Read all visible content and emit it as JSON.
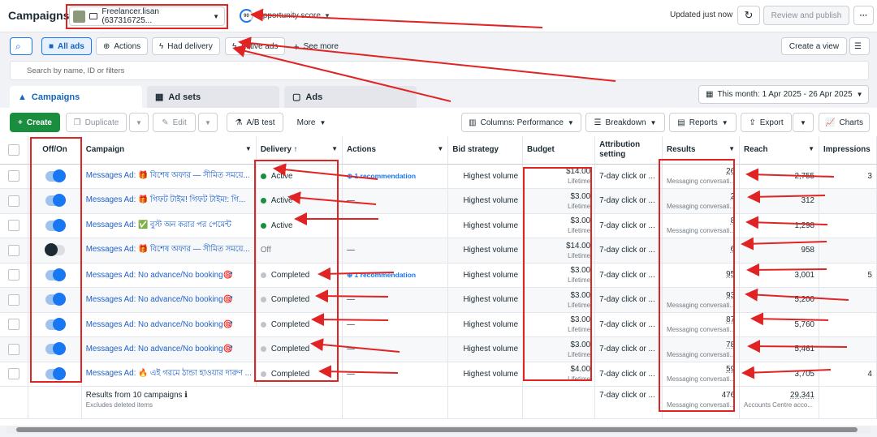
{
  "topbar": {
    "title": "Campaigns",
    "account": "Freelancer.lisan (637316725...",
    "opportunity_score": "90",
    "opportunity_label": "Opportunity score",
    "updated": "Updated just now",
    "review_publish": "Review and publish",
    "more": "···"
  },
  "filters": {
    "all_ads": "All ads",
    "actions": "Actions",
    "had_delivery": "Had delivery",
    "active_ads": "Active ads",
    "see_more": "See more",
    "create_view": "Create a view",
    "search_placeholder": "Search by name, ID or filters"
  },
  "tabs": {
    "campaigns": "Campaigns",
    "adsets": "Ad sets",
    "ads": "Ads"
  },
  "date_range": "This month: 1 Apr 2025 - 26 Apr 2025",
  "toolbar": {
    "create": "Create",
    "duplicate": "Duplicate",
    "edit": "Edit",
    "ab_test": "A/B test",
    "more": "More",
    "columns": "Columns: Performance",
    "breakdown": "Breakdown",
    "reports": "Reports",
    "export": "Export",
    "charts": "Charts"
  },
  "columns": {
    "offon": "Off/On",
    "campaign": "Campaign",
    "delivery": "Delivery ↑",
    "actions": "Actions",
    "bid": "Bid strategy",
    "budget": "Budget",
    "attribution": "Attribution setting",
    "results": "Results",
    "reach": "Reach",
    "impressions": "Impressions"
  },
  "rows": [
    {
      "on": true,
      "name": "Messages Ad: 🎁 বিশেষ অফার — সীমিত সময়ে...",
      "delivery": "Active",
      "status": "active",
      "action": "1 recommendation",
      "bid": "Highest volume",
      "budget": "$14.00",
      "budget_sub": "Lifetime",
      "attr": "7-day click or ...",
      "result": "26",
      "result_sub": "Messaging conversati...",
      "reach": "2,755",
      "impr": "3"
    },
    {
      "on": true,
      "name": "Messages Ad: 🎁 গিফট টাইম! গিফট টাইম!: গি...",
      "delivery": "Active",
      "status": "active",
      "action": "—",
      "bid": "Highest volume",
      "budget": "$3.00",
      "budget_sub": "Lifetime",
      "attr": "7-day click or ...",
      "result": "2",
      "result_sub": "Messaging conversati...",
      "reach": "312",
      "impr": ""
    },
    {
      "on": true,
      "name": "Messages Ad: ✅ বুস্ট অন করার পর পেমেন্ট",
      "delivery": "Active",
      "status": "active",
      "action": "",
      "bid": "Highest volume",
      "budget": "$3.00",
      "budget_sub": "Lifetime",
      "attr": "7-day click or ...",
      "result": "8",
      "result_sub": "Messaging conversati...",
      "reach": "1,298",
      "impr": ""
    },
    {
      "on": false,
      "name": "Messages Ad: 🎁 বিশেষ অফার — সীমিত সময়ে...",
      "delivery": "Off",
      "status": "off",
      "action": "—",
      "bid": "Highest volume",
      "budget": "$14.00",
      "budget_sub": "Lifetime",
      "attr": "7-day click or ...",
      "result": "6",
      "result_sub": "",
      "reach": "958",
      "impr": ""
    },
    {
      "on": true,
      "name": "Messages Ad: No advance/No booking🎯",
      "delivery": "Completed",
      "status": "completed",
      "action": "1 recommendation",
      "bid": "Highest volume",
      "budget": "$3.00",
      "budget_sub": "Lifetime",
      "attr": "7-day click or ...",
      "result": "95",
      "result_sub": "",
      "reach": "3,001",
      "impr": "5"
    },
    {
      "on": true,
      "name": "Messages Ad: No advance/No booking🎯",
      "delivery": "Completed",
      "status": "completed",
      "action": "—",
      "bid": "Highest volume",
      "budget": "$3.00",
      "budget_sub": "Lifetime",
      "attr": "7-day click or ...",
      "result": "93",
      "result_sub": "Messaging conversati...",
      "reach": "5,200",
      "impr": ""
    },
    {
      "on": true,
      "name": "Messages Ad: No advance/No booking🎯",
      "delivery": "Completed",
      "status": "completed",
      "action": "—",
      "bid": "Highest volume",
      "budget": "$3.00",
      "budget_sub": "Lifetime",
      "attr": "7-day click or ...",
      "result": "87",
      "result_sub": "Messaging conversati...",
      "reach": "5,760",
      "impr": ""
    },
    {
      "on": true,
      "name": "Messages Ad: No advance/No booking🎯",
      "delivery": "Completed",
      "status": "completed",
      "action": "—",
      "bid": "Highest volume",
      "budget": "$3.00",
      "budget_sub": "Lifetime",
      "attr": "7-day click or ...",
      "result": "78",
      "result_sub": "Messaging conversati...",
      "reach": "5,461",
      "impr": ""
    },
    {
      "on": true,
      "name": "Messages Ad: 🔥 এই গরমে ঠান্ডা হাওয়ার দারুণ ...",
      "delivery": "Completed",
      "status": "completed",
      "action": "—",
      "bid": "Highest volume",
      "budget": "$4.00",
      "budget_sub": "Lifetime",
      "attr": "7-day click or ...",
      "result": "59",
      "result_sub": "Messaging conversati...",
      "reach": "3,705",
      "impr": "4"
    }
  ],
  "footer": {
    "results_from": "Results from 10 campaigns ℹ",
    "excluded": "Excludes deleted items",
    "attr": "7-day click or ...",
    "total_results": "476",
    "total_results_sub": "Messaging conversati...",
    "total_reach": "29,341",
    "total_reach_sub": "Accounts Centre acco..."
  },
  "colors": {
    "accent": "#1877f2",
    "annotation": "#e02424",
    "create": "#1a8e3f"
  }
}
